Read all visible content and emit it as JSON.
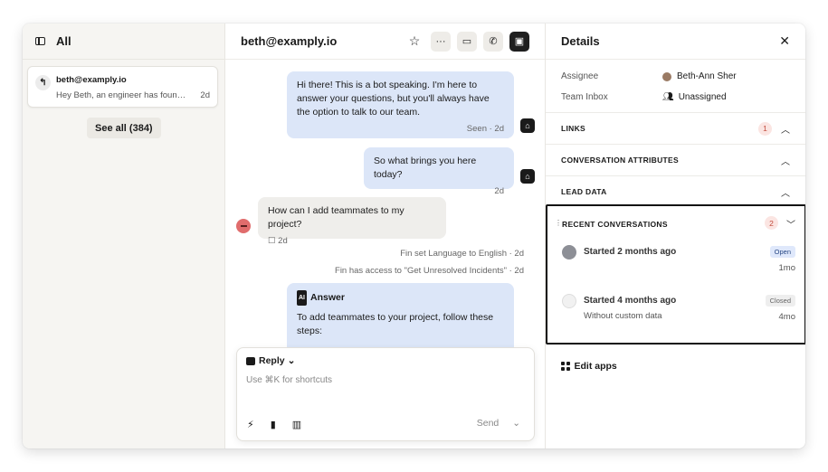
{
  "left": {
    "title": "All",
    "conversation": {
      "email": "beth@examply.io",
      "preview": "Hey Beth, an engineer has found t...",
      "time": "2d"
    },
    "see_all": "See all (384)"
  },
  "center": {
    "title": "beth@examply.io",
    "messages": {
      "bot1": "Hi there! This is a bot speaking. I'm here to answer your questions, but you'll always have the option to talk to our team.",
      "bot1_meta": "Seen · 2d",
      "bot2": "So what brings you here today?",
      "bot2_meta": "2d",
      "user1": "How can I add teammates to my project?",
      "user1_meta": "2d",
      "note1": "Fin set Language to English · 2d",
      "note2": "Fin has access to \"Get Unresolved Incidents\" · 2d",
      "answer_chip": "AI",
      "answer_label": "Answer",
      "answer_text": "To add teammates to your project, follow these steps:"
    },
    "reply": {
      "label": "Reply",
      "placeholder": "Use ⌘K for shortcuts",
      "send": "Send"
    }
  },
  "right": {
    "title": "Details",
    "assignee_label": "Assignee",
    "assignee_value": "Beth-Ann Sher",
    "team_label": "Team Inbox",
    "team_value": "Unassigned",
    "links": {
      "title": "LINKS",
      "count": "1"
    },
    "attributes": {
      "title": "CONVERSATION ATTRIBUTES"
    },
    "lead": {
      "title": "LEAD DATA"
    },
    "recent": {
      "title": "RECENT CONVERSATIONS",
      "count": "2",
      "items": [
        {
          "title": "Started 2 months ago",
          "state": "Open",
          "ago": "1mo"
        },
        {
          "title": "Started 4 months ago",
          "subtitle": "Without custom data",
          "state": "Closed",
          "ago": "4mo"
        }
      ]
    },
    "edit_apps": "Edit apps"
  },
  "colors": {
    "bot_bubble": "#dce6f8",
    "user_bubble": "#efeeeb",
    "badge_bg": "#fbe5e2",
    "badge_fg": "#c24b3d",
    "open_bg": "#dfe8fb",
    "closed_bg": "#eeeeee"
  }
}
